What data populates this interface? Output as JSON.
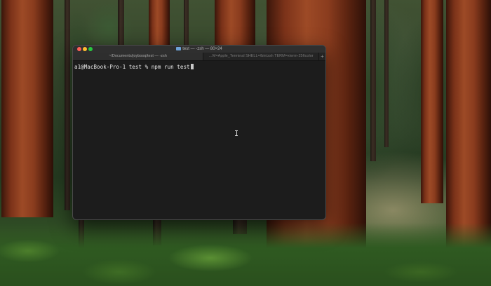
{
  "window": {
    "title": "test — -zsh — 80×24",
    "title_icon": "folder-icon"
  },
  "tabs": [
    {
      "label": "~/Documents/joybooq/test — -zsh",
      "active": true
    },
    {
      "label": "…M=Apple_Terminal SHELL=/bin/zsh TERM=xterm-256color",
      "active": false
    }
  ],
  "tab_add_label": "+",
  "terminal": {
    "prompt": "a1@MacBook-Pro-1 test % ",
    "command": "npm run test"
  },
  "colors": {
    "terminal_bg": "#1c1c1c",
    "close": "#ff5f57",
    "minimize": "#febc2e",
    "maximize": "#28c840"
  }
}
